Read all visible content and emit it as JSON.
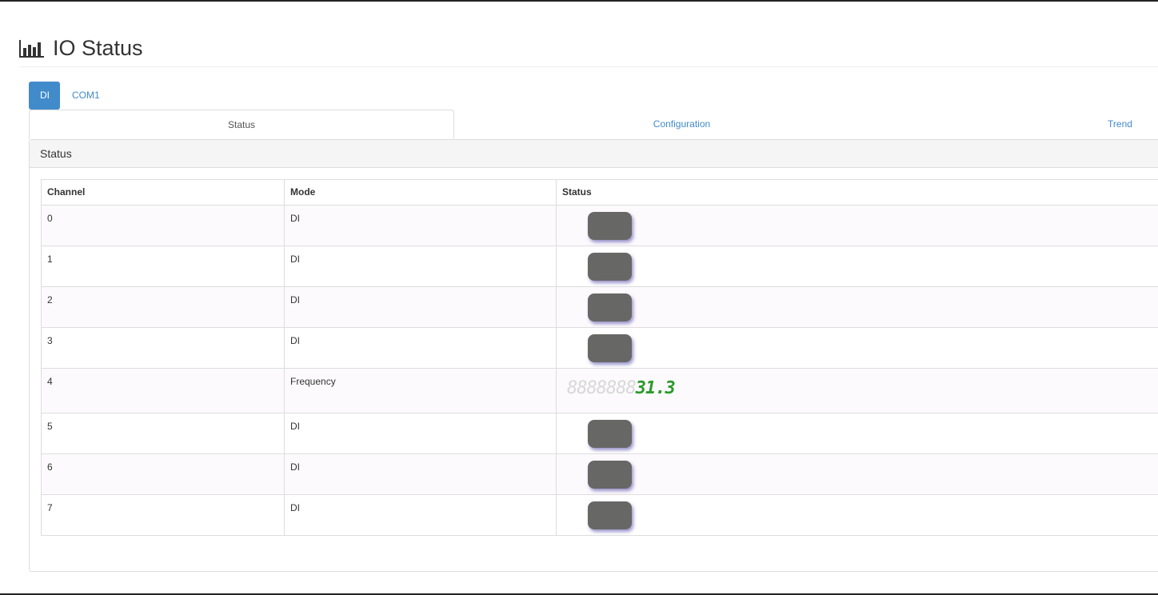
{
  "page": {
    "title": "IO Status"
  },
  "pill_tabs": [
    {
      "label": "DI",
      "active": true
    },
    {
      "label": "COM1",
      "active": false
    }
  ],
  "sub_tabs": [
    {
      "label": "Status",
      "active": true
    },
    {
      "label": "Configuration",
      "active": false
    },
    {
      "label": "Trend",
      "active": false
    }
  ],
  "panel": {
    "heading": "Status"
  },
  "table": {
    "headers": {
      "channel": "Channel",
      "mode": "Mode",
      "status": "Status"
    },
    "rows": [
      {
        "channel": "0",
        "mode": "DI",
        "status": "off"
      },
      {
        "channel": "1",
        "mode": "DI",
        "status": "off"
      },
      {
        "channel": "2",
        "mode": "DI",
        "status": "off"
      },
      {
        "channel": "3",
        "mode": "DI",
        "status": "off"
      },
      {
        "channel": "4",
        "mode": "Frequency",
        "status": "31.3",
        "display_ghost": "8888888"
      },
      {
        "channel": "5",
        "mode": "DI",
        "status": "off"
      },
      {
        "channel": "6",
        "mode": "DI",
        "status": "off"
      },
      {
        "channel": "7",
        "mode": "DI",
        "status": "off"
      }
    ]
  },
  "colors": {
    "accent": "#428bca",
    "led_off": "#676866",
    "segment_lit": "#2a9a2a"
  }
}
